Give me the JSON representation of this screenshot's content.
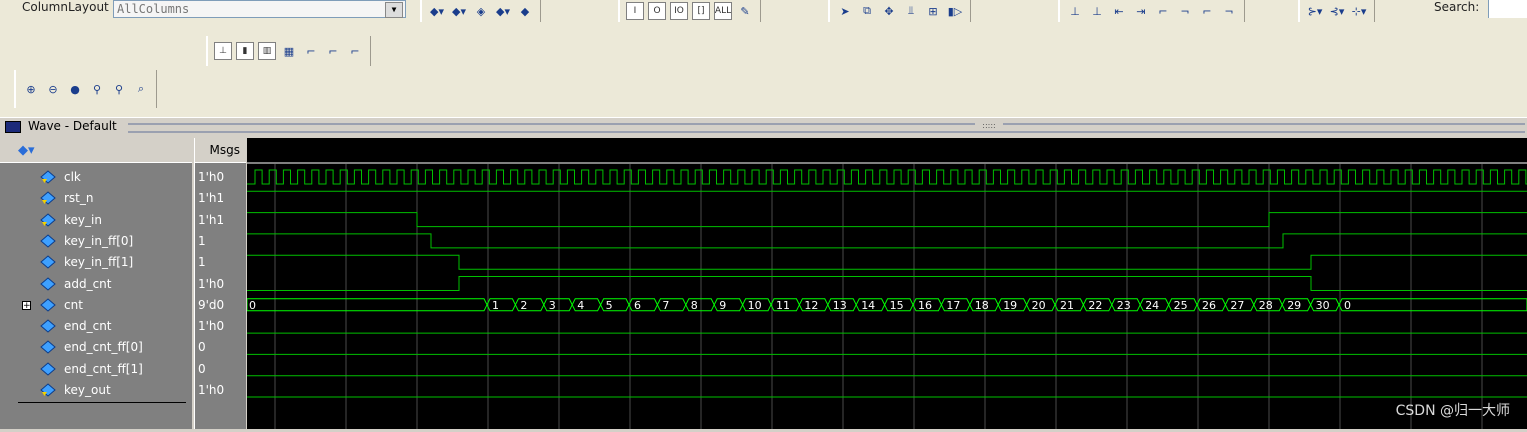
{
  "toolbar": {
    "column_layout_label": "ColumnLayout",
    "column_layout_value": "AllColumns",
    "search_label": "Search:"
  },
  "window": {
    "title": "Wave - Default"
  },
  "panes": {
    "msgs_header": "Msgs"
  },
  "signals": [
    {
      "name": "clk",
      "value": "1'h0"
    },
    {
      "name": "rst_n",
      "value": "1'h1"
    },
    {
      "name": "key_in",
      "value": "1'h1"
    },
    {
      "name": "key_in_ff[0]",
      "value": "1"
    },
    {
      "name": "key_in_ff[1]",
      "value": "1"
    },
    {
      "name": "add_cnt",
      "value": "1'h0"
    },
    {
      "name": "cnt",
      "value": "9'd0"
    },
    {
      "name": "end_cnt",
      "value": "1'h0"
    },
    {
      "name": "end_cnt_ff[0]",
      "value": "0"
    },
    {
      "name": "end_cnt_ff[1]",
      "value": "0"
    },
    {
      "name": "key_out",
      "value": "1'h0"
    }
  ],
  "cnt_bus_values": [
    "0",
    "1",
    "2",
    "3",
    "4",
    "5",
    "6",
    "7",
    "8",
    "9",
    "10",
    "11",
    "12",
    "13",
    "14",
    "15",
    "16",
    "17",
    "18",
    "19",
    "20",
    "21",
    "22",
    "23",
    "24",
    "25",
    "26",
    "27",
    "28",
    "29",
    "30",
    "0"
  ],
  "watermark": "CSDN @归一大师",
  "colors": {
    "wave": "#00c000",
    "bus": "#00ff00",
    "grid": "#4a4a4a",
    "pane": "#808080"
  }
}
